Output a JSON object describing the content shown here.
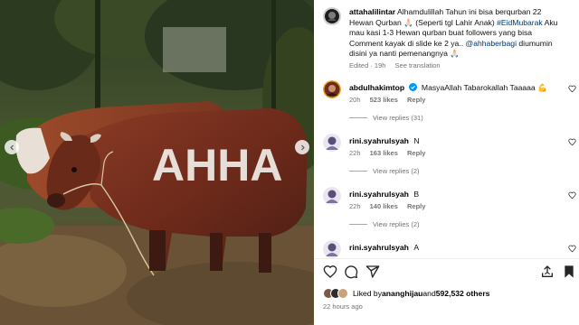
{
  "photo": {
    "painted_text": "AHHA"
  },
  "caption": {
    "username": "attahalilintar",
    "text_part1": "Alhamdulillah Tahun ini bisa berqurban 22 Hewan Qurban 🙏🏻 (Seperti tgl Lahir Anak) ",
    "hashtag": "#EidMubarak",
    "text_part2": " Aku mau kasi 1-3 Hewan qurban buat followers yang bisa Comment kayak di slide ke 2 ya.. ",
    "mention": "@ahhaberbagi",
    "text_part3": " diumumin disini ya nanti pemenangnya 🙏🏻",
    "edited": "Edited · 19h",
    "see_translation": "See translation"
  },
  "comments": [
    {
      "username": "abdulhakimtop",
      "verified": true,
      "text": "MasyaAllah Tabarokallah Taaaaa 💪",
      "time": "20h",
      "likes": "523 likes",
      "reply": "Reply",
      "view_replies": "View replies (31)"
    },
    {
      "username": "rini.syahrulsyah",
      "verified": false,
      "text": "N",
      "time": "22h",
      "likes": "163 likes",
      "reply": "Reply",
      "view_replies": "View replies (2)"
    },
    {
      "username": "rini.syahrulsyah",
      "verified": false,
      "text": "B",
      "time": "22h",
      "likes": "140 likes",
      "reply": "Reply",
      "view_replies": "View replies (2)"
    },
    {
      "username": "rini.syahrulsyah",
      "verified": false,
      "text": "A"
    }
  ],
  "actions": {
    "icons": [
      "heart-icon",
      "comment-icon",
      "share-icon",
      "save-icon"
    ]
  },
  "likes": {
    "prefix": "Liked by ",
    "user": "ananghijau",
    "connector": " and ",
    "count": "592,532 others"
  },
  "timestamp": "22 hours ago",
  "colors": {
    "link": "#00376b",
    "muted": "#737373",
    "verified": "#0095f6"
  }
}
